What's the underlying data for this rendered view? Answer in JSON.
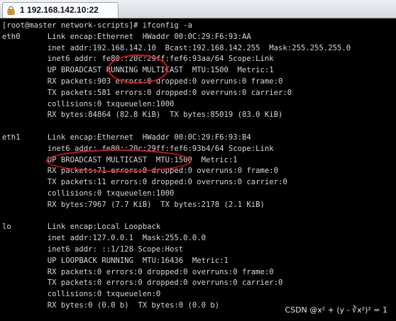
{
  "tab": {
    "index": "1",
    "title": "192.168.142.10:22",
    "icon": "lock-icon",
    "icon_color": "#e0a020"
  },
  "terminal": {
    "lines": [
      "[root@master network-scripts]# ifconfig -a",
      "eth0      Link encap:Ethernet  HWaddr 00:0C:29:F6:93:AA",
      "          inet addr:192.168.142.10  Bcast:192.168.142.255  Mask:255.255.255.0",
      "          inet6 addr: fe80::20c:29ff:fef6:93aa/64 Scope:Link",
      "          UP BROADCAST RUNNING MULTICAST  MTU:1500  Metric:1",
      "          RX packets:903 errors:0 dropped:0 overruns:0 frame:0",
      "          TX packets:581 errors:0 dropped:0 overruns:0 carrier:0",
      "          collisions:0 txqueuelen:1000",
      "          RX bytes:84864 (82.8 KiB)  TX bytes:85019 (83.0 KiB)",
      "",
      "eth1      Link encap:Ethernet  HWaddr 00:0C:29:F6:93:B4",
      "          inet6 addr: fe80::20c:29ff:fef6:93b4/64 Scope:Link",
      "          UP BROADCAST MULTICAST  MTU:1500  Metric:1",
      "          RX packets:71 errors:0 dropped:0 overruns:0 frame:0",
      "          TX packets:11 errors:0 dropped:0 overruns:0 carrier:0",
      "          collisions:0 txqueuelen:1000",
      "          RX bytes:7967 (7.7 KiB)  TX bytes:2178 (2.1 KiB)",
      "",
      "lo        Link encap:Local Loopback",
      "          inet addr:127.0.0.1  Mask:255.0.0.0",
      "          inet6 addr: ::1/128 Scope:Host",
      "          UP LOOPBACK RUNNING  MTU:16436  Metric:1",
      "          RX packets:0 errors:0 dropped:0 overruns:0 frame:0",
      "          TX packets:0 errors:0 dropped:0 overruns:0 carrier:0",
      "          collisions:0 txqueuelen:0",
      "          RX bytes:0 (0.0 b)  TX bytes:0 (0.0 b)"
    ],
    "text_color": "#d7d7d7",
    "background_color": "#000000"
  },
  "annotations": {
    "color": "#d8141b"
  },
  "watermark": {
    "text": "CSDN @x² + (y - ∛x²)² = 1"
  }
}
